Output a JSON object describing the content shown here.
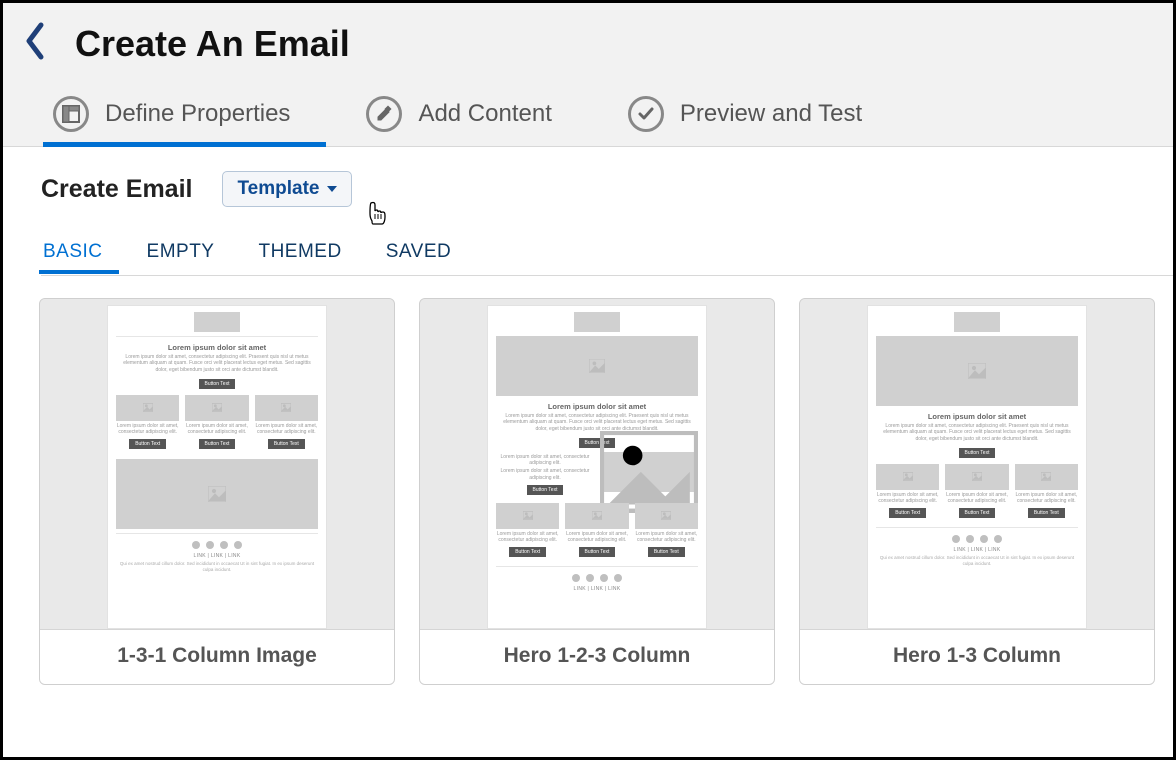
{
  "header": {
    "title": "Create An Email"
  },
  "steps": [
    {
      "label": "Define Properties",
      "icon": "layout-icon",
      "active": true
    },
    {
      "label": "Add Content",
      "icon": "pencil-icon",
      "active": false
    },
    {
      "label": "Preview and Test",
      "icon": "check-icon",
      "active": false
    }
  ],
  "create": {
    "title": "Create Email",
    "dropdown_label": "Template"
  },
  "categoryTabs": [
    {
      "label": "BASIC",
      "active": true
    },
    {
      "label": "EMPTY",
      "active": false
    },
    {
      "label": "THEMED",
      "active": false
    },
    {
      "label": "SAVED",
      "active": false
    }
  ],
  "templates": [
    {
      "name": "1-3-1 Column Image"
    },
    {
      "name": "Hero 1-2-3 Column"
    },
    {
      "name": "Hero 1-3 Column"
    }
  ],
  "mock": {
    "heading": "Lorem ipsum dolor sit amet",
    "para": "Lorem ipsum dolor sit amet, consectetur adipiscing elit. Praesent quis nisl ut metus elementum aliquam at quam. Fusce orci velit placerat lectus eget metus. Sed sagittis dolor, eget bibendum justo sit orci ante dictumst blandit.",
    "small": "Lorem ipsum dolor sit amet, consectetur adipiscing elit.",
    "button": "Button Text",
    "links": "LINK  |  LINK  |  LINK",
    "footer": "Qui ex amet nostrud cillum dolor. Sed incididunt in occaecat Ut in sint fugiat. In ex ipsum deserunt culpa incidunt."
  }
}
